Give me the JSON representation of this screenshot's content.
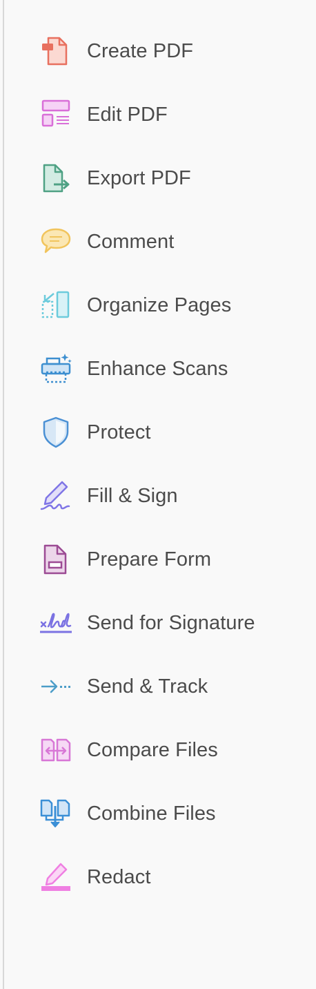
{
  "tools": [
    {
      "label": "Create PDF",
      "icon": "create-pdf-icon",
      "color": "#e8705f"
    },
    {
      "label": "Edit PDF",
      "icon": "edit-pdf-icon",
      "color": "#d96fd8"
    },
    {
      "label": "Export PDF",
      "icon": "export-pdf-icon",
      "color": "#4fa184"
    },
    {
      "label": "Comment",
      "icon": "comment-icon",
      "color": "#f1c45c"
    },
    {
      "label": "Organize Pages",
      "icon": "organize-pages-icon",
      "color": "#6ccbdc"
    },
    {
      "label": "Enhance Scans",
      "icon": "enhance-scans-icon",
      "color": "#3d8fd0"
    },
    {
      "label": "Protect",
      "icon": "protect-icon",
      "color": "#4a90d4"
    },
    {
      "label": "Fill & Sign",
      "icon": "fill-sign-icon",
      "color": "#7f75e6"
    },
    {
      "label": "Prepare Form",
      "icon": "prepare-form-icon",
      "color": "#9c4b94"
    },
    {
      "label": "Send for Signature",
      "icon": "send-for-signature-icon",
      "color": "#7b72e2"
    },
    {
      "label": "Send & Track",
      "icon": "send-track-icon",
      "color": "#4c9dc8"
    },
    {
      "label": "Compare Files",
      "icon": "compare-files-icon",
      "color": "#d877d6"
    },
    {
      "label": "Combine Files",
      "icon": "combine-files-icon",
      "color": "#3b8fd6"
    },
    {
      "label": "Redact",
      "icon": "redact-icon",
      "color": "#ef7fe2"
    }
  ]
}
